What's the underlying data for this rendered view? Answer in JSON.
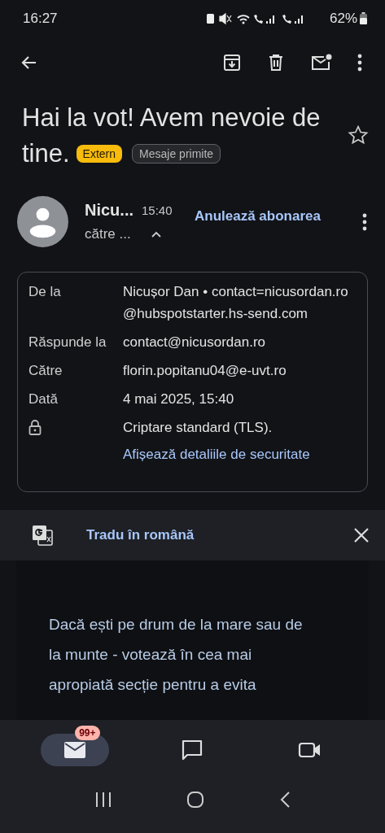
{
  "status_bar": {
    "time": "16:27",
    "battery": "62%"
  },
  "subject": {
    "title_lines": [
      "Hai la vot! Avem nevoie de",
      "tine."
    ],
    "labels": [
      {
        "text": "Extern",
        "kind": "external"
      },
      {
        "text": "Mesaje primite",
        "kind": "folder"
      }
    ],
    "starred": false
  },
  "sender": {
    "name": "Nicu...",
    "time": "15:40",
    "recipient": "către ...",
    "expanded": true,
    "unsubscribe": "Anulează abonarea"
  },
  "details": [
    {
      "kind": "field",
      "label": "De la",
      "value": "Nicușor Dan • contact=nicusordan.ro@hubspotstarter.hs-send.com"
    },
    {
      "kind": "field",
      "label": "Răspunde la",
      "value": "contact@nicusordan.ro"
    },
    {
      "kind": "field",
      "label": "Către",
      "value": "florin.popitanu04@e-uvt.ro"
    },
    {
      "kind": "field",
      "label": "Dată",
      "value": "4 mai 2025, 15:40"
    },
    {
      "kind": "security",
      "value": "Criptare standard (TLS).",
      "link": "Afișează detaliile de securitate"
    }
  ],
  "translate_bar": {
    "label": "Tradu în română"
  },
  "body": {
    "text": "Dacă ești pe drum de la mare sau de la munte - votează în cea mai apropiată secție pentru a evita"
  },
  "bottom_nav": [
    {
      "kind": "mail",
      "selected": true,
      "badge": "99+"
    },
    {
      "kind": "chat",
      "selected": false
    },
    {
      "kind": "video",
      "selected": false
    }
  ]
}
